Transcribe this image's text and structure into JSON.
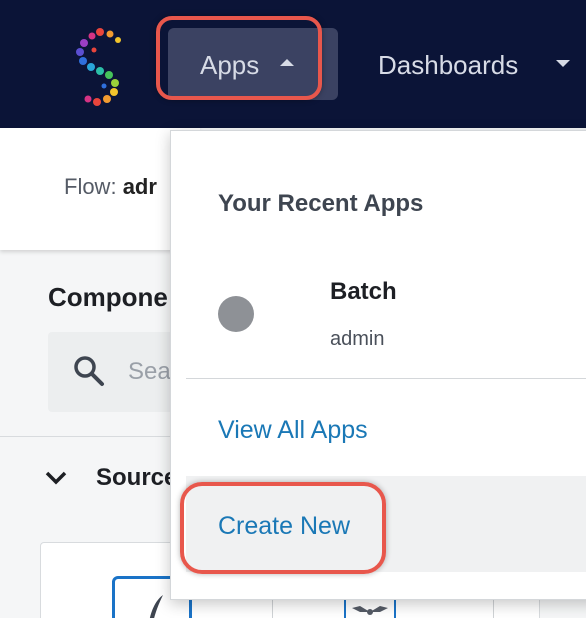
{
  "nav": {
    "apps_label": "Apps",
    "dashboards_label": "Dashboards"
  },
  "page": {
    "flow_prefix": "Flow:",
    "flow_name": "adr",
    "components_title": "Compone",
    "search_placeholder": "Sea",
    "sources_label": "Source"
  },
  "apps_menu": {
    "heading": "Your Recent Apps",
    "recent_apps": [
      {
        "name": "Batch",
        "owner": "admin"
      }
    ],
    "view_all_label": "View All Apps",
    "create_new_label": "Create New"
  },
  "colors": {
    "nav_bg": "#0b1437",
    "active_nav_bg": "#3b4262",
    "highlight": "#e8574c",
    "link": "#1a78b6"
  }
}
